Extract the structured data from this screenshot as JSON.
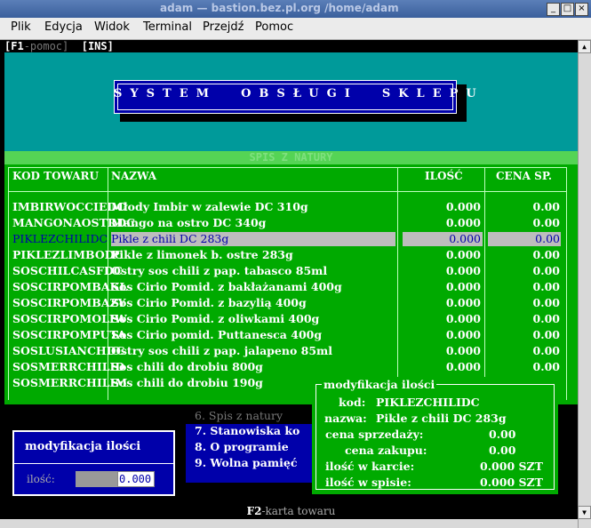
{
  "window": {
    "title": "adam — bastion.bez.pl.org /home/adam"
  },
  "menubar": [
    "Plik",
    "Edycja",
    "Widok",
    "Terminal",
    "Przejdź",
    "Pomoc"
  ],
  "topbar": {
    "f1_key": "[F1",
    "f1_text": "-pomoc]",
    "ins": "[INS]"
  },
  "system_title": "SYSTEM  OBSŁUGI  SKLEPU",
  "list": {
    "title": "SPIS Z NATURY",
    "headers": {
      "code": "KOD TOWARU",
      "name": "NAZWA",
      "qty": "ILOŚĆ",
      "price": "CENA SP."
    },
    "rows": [
      {
        "code": "IMBIRWOCCIEDC",
        "name": "Młody Imbir w zalewie DC 310g",
        "qty": "0.000",
        "price": "0.00"
      },
      {
        "code": "MANGONAOSTRDC",
        "name": "Mango na ostro DC 340g",
        "qty": "0.000",
        "price": "0.00"
      },
      {
        "code": "PIKLEZCHILIDC",
        "name": "Pikle z chili DC 283g",
        "qty": "0.000",
        "price": "0.00"
      },
      {
        "code": "PIKLEZLIMBODC",
        "name": "Pikle z limonek b. ostre 283g",
        "qty": "0.000",
        "price": "0.00"
      },
      {
        "code": "SOSCHILCASFDC",
        "name": "Ostry sos chili z pap. tabasco 85ml",
        "qty": "0.000",
        "price": "0.00"
      },
      {
        "code": "SOSCIRPOMBAKŁ",
        "name": "Sos Cirio Pomid. z bakłażanami 400g",
        "qty": "0.000",
        "price": "0.00"
      },
      {
        "code": "SOSCIRPOMBAZY",
        "name": "Sos Cirio Pomid. z bazylią 400g",
        "qty": "0.000",
        "price": "0.00"
      },
      {
        "code": "SOSCIRPOMOLIW",
        "name": "Sos Cirio Pomid. z oliwkami 400g",
        "qty": "0.000",
        "price": "0.00"
      },
      {
        "code": "SOSCIRPOMPUTA",
        "name": "Sos Cirio pomid. Puttanesca 400g",
        "qty": "0.000",
        "price": "0.00"
      },
      {
        "code": "SOSLUSIANCHDC",
        "name": "Ostry sos chili z pap. jalapeno 85ml",
        "qty": "0.000",
        "price": "0.00"
      },
      {
        "code": "SOSMERRCHILID",
        "name": "Sos chili do drobiu 800g",
        "qty": "0.000",
        "price": "0.00"
      },
      {
        "code": "SOSMERRCHILIM",
        "name": "Sos chili do drobiu 190g",
        "qty": "",
        "price": ""
      }
    ]
  },
  "bg_menu": [
    "6. Spis z natury",
    "7. Stanowiska ko",
    "8. O programie",
    "9. Wolna pamięć"
  ],
  "qty_dialog": {
    "title": "modyfikacja ilości",
    "label": "ilość:",
    "value": "0.000"
  },
  "mod_dialog": {
    "title": "modyfikacja ilości",
    "lines": [
      {
        "label": "kod:",
        "value": "PIKLEZCHILIDC"
      },
      {
        "label": "nazwa:",
        "value": "Pikle z chili DC 283g"
      },
      {
        "label": "cena sprzedaży:",
        "value": "0.00"
      },
      {
        "label": "cena zakupu:",
        "value": "0.00"
      },
      {
        "label": "ilość w karcie:",
        "value": "0.000 SZT"
      },
      {
        "label": "ilość w spisie:",
        "value": "0.000 SZT"
      }
    ]
  },
  "statusbar": {
    "key": "F2",
    "text": "-karta towaru"
  }
}
